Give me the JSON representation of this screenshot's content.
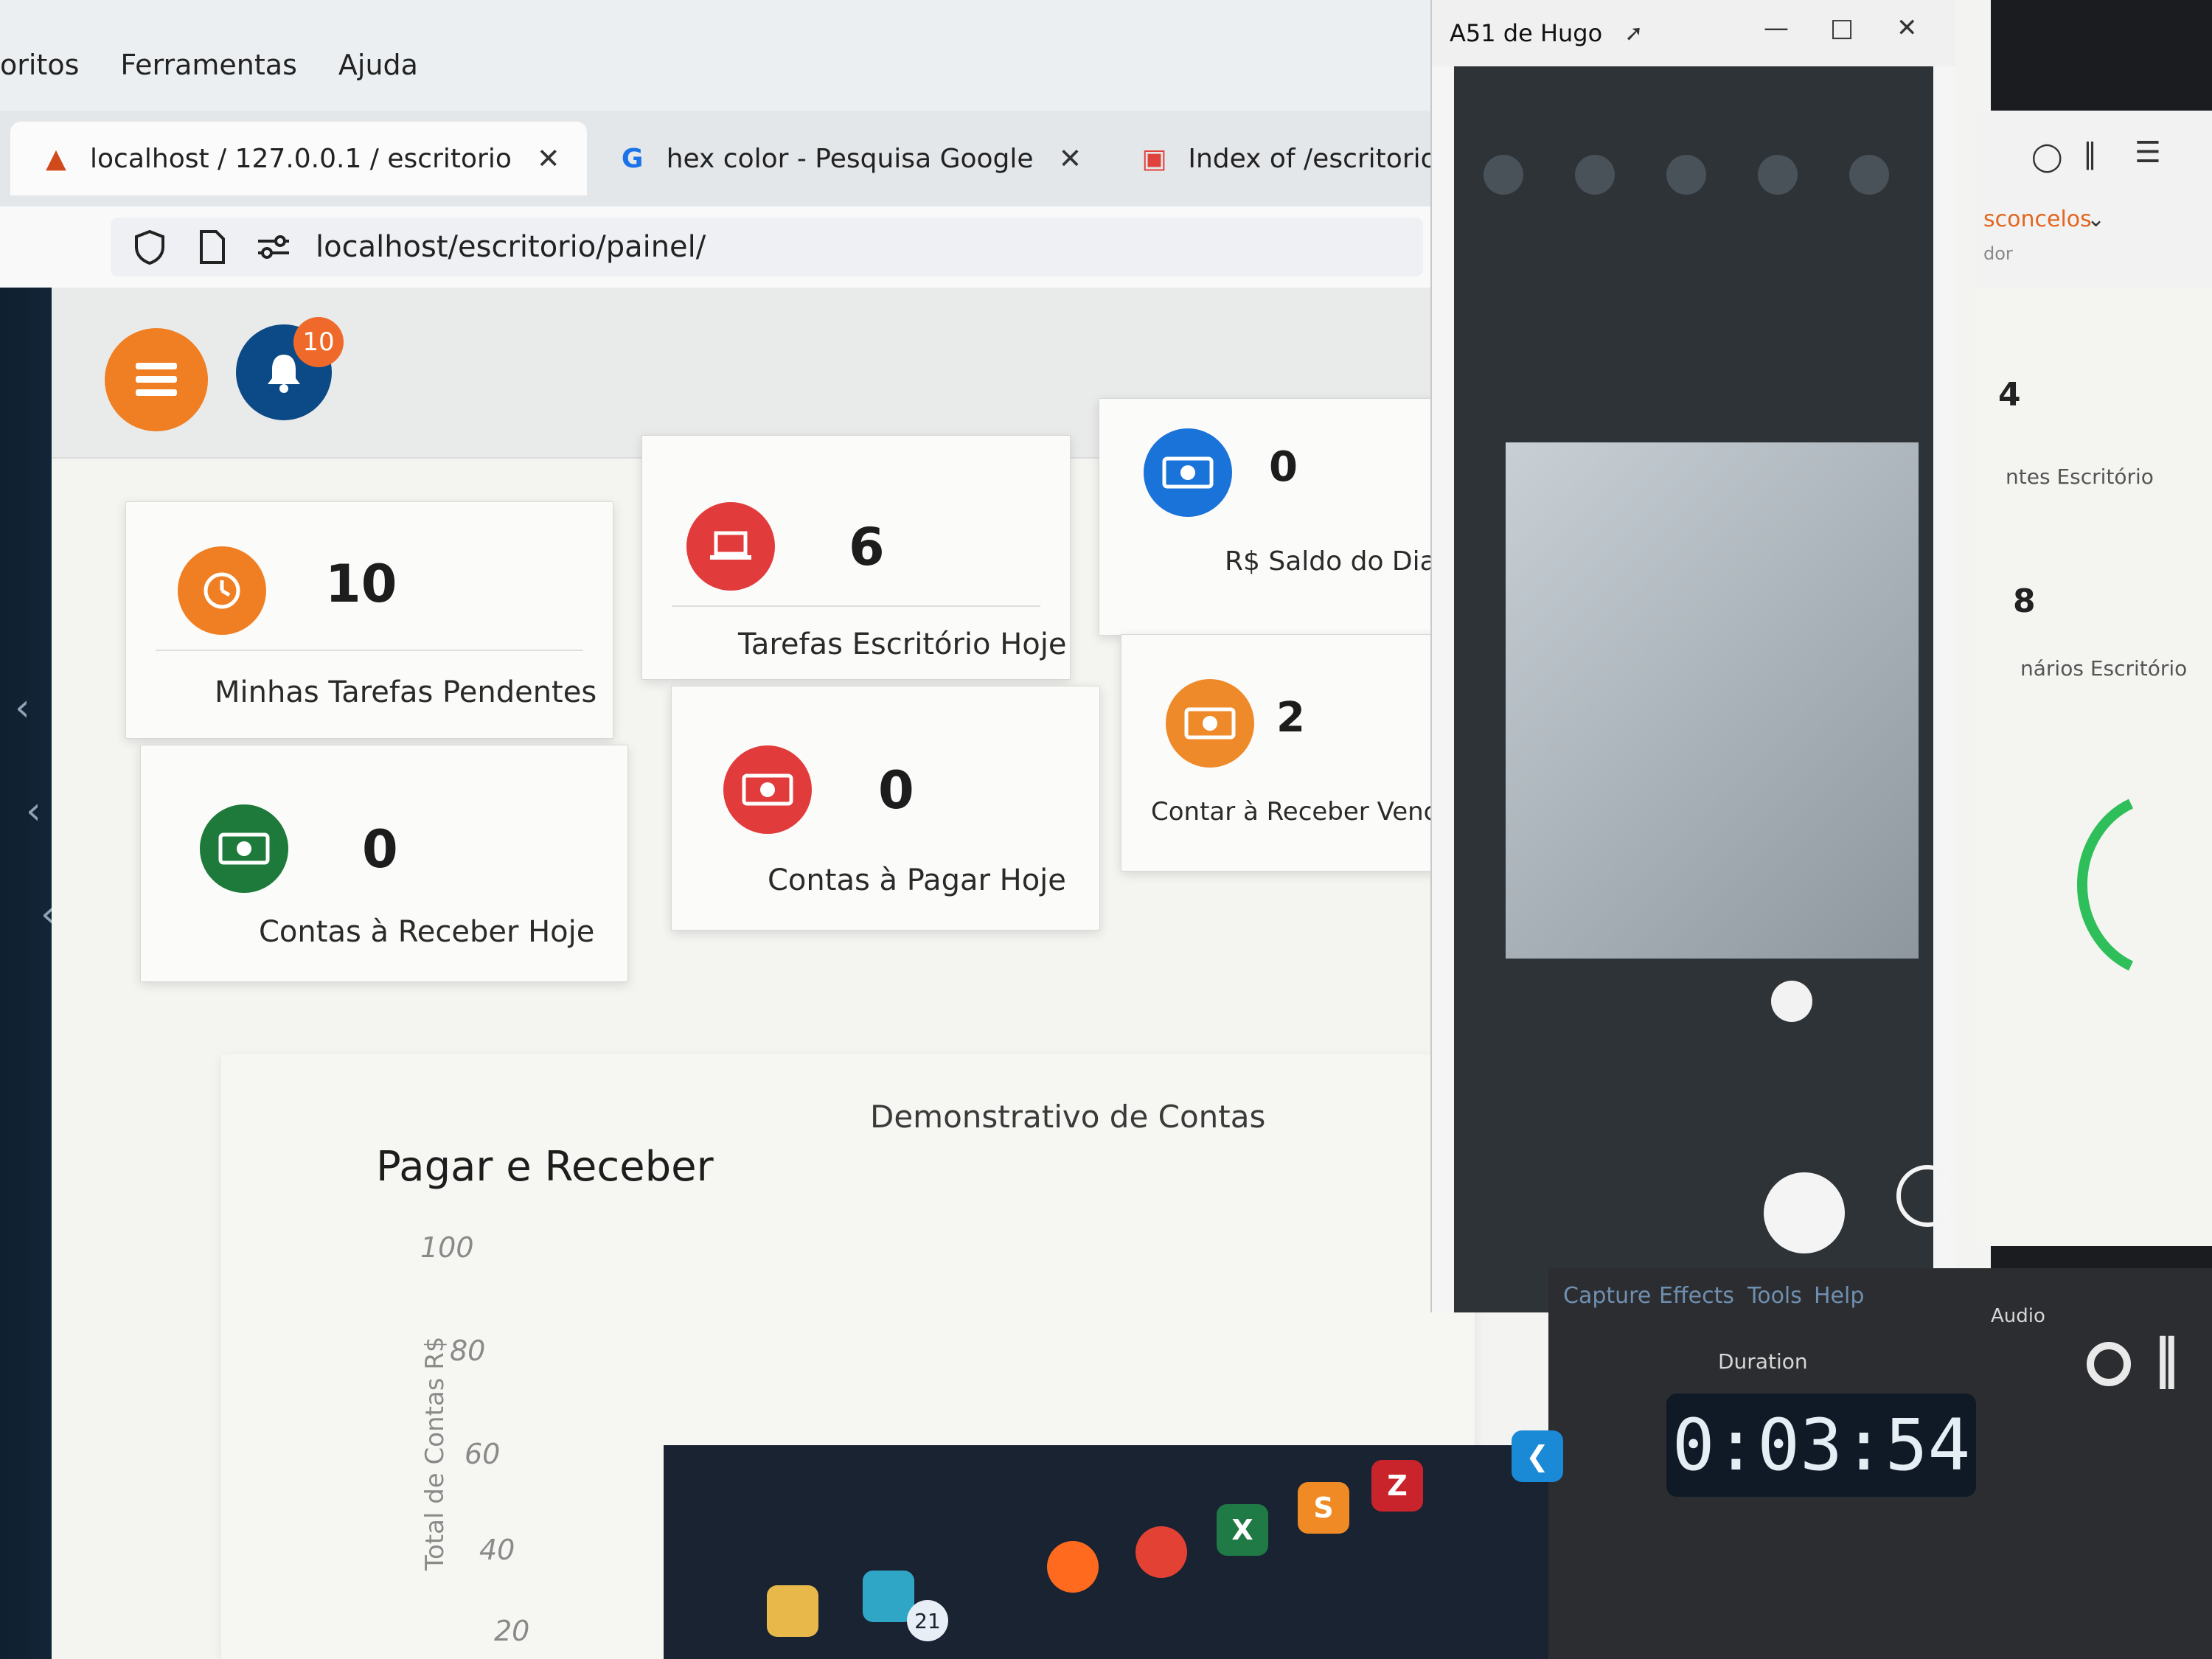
{
  "browser": {
    "menu": [
      "oritos",
      "Ferramentas",
      "Ajuda"
    ],
    "tabs": [
      {
        "title": "localhost / 127.0.0.1 / escritorio",
        "icon": "phpmyadmin-icon"
      },
      {
        "title": "hex color - Pesquisa Google",
        "icon": "google-icon"
      },
      {
        "title": "Index of /escritorio/api",
        "icon": "xampp-icon"
      }
    ],
    "url": "localhost/escritorio/painel/"
  },
  "header": {
    "notification_count": "10"
  },
  "cards": [
    {
      "value": "10",
      "label": "Minhas Tarefas Pendentes",
      "color": "#ef7f22",
      "icon": "clock-icon"
    },
    {
      "value": "0",
      "label": "Contas à Receber Hoje",
      "color": "#1d7a3a",
      "icon": "money-icon"
    },
    {
      "value": "6",
      "label": "Tarefas Escritório Hoje",
      "color": "#e23b3b",
      "icon": "laptop-icon"
    },
    {
      "value": "0",
      "label": "Contas à Pagar Hoje",
      "color": "#e23b3b",
      "icon": "money-icon"
    },
    {
      "value": "0",
      "label": "R$ Saldo do Dia",
      "color": "#1a73d9",
      "icon": "money-icon"
    },
    {
      "value": "2",
      "label": "Contar à Receber Vencidas",
      "color": "#ef8a2a",
      "icon": "money-icon"
    }
  ],
  "charts": {
    "title": "Pagar e Receber",
    "title2": "Demonstrativo de Contas",
    "y_label": "Total de Contas R$",
    "y_ticks": [
      "100",
      "80",
      "60",
      "40",
      "20"
    ]
  },
  "camera_window": {
    "title": "A51 de Hugo"
  },
  "right_panel": {
    "user_name": "sconcelos",
    "user_role": "dor",
    "stat1_value": "4",
    "stat1_label": "ntes Escritório",
    "stat2_value": "8",
    "stat2_label": "nários Escritório"
  },
  "recorder": {
    "menu": [
      "Capture",
      "Effects",
      "Tools",
      "Help"
    ],
    "duration_label": "Duration",
    "duration": "0:03:54",
    "audio_label": "Audio"
  },
  "taskbar": {
    "badge": "21"
  },
  "colors": {
    "accent_orange": "#ef7f22",
    "bell_blue": "#0c4a87"
  }
}
